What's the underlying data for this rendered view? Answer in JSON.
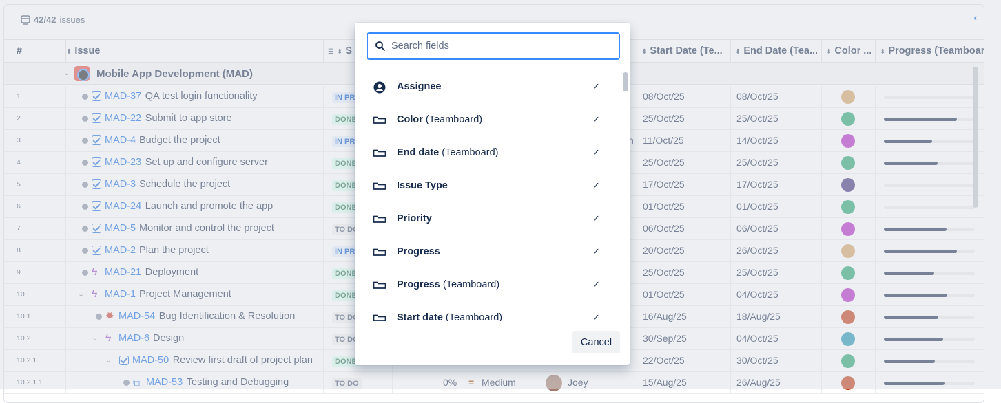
{
  "toolbar": {
    "count_bold": "42/42",
    "count_label": "issues",
    "collapse_icon": "chevron-left-icon"
  },
  "columns": [
    {
      "label": "#"
    },
    {
      "label": "Issue"
    },
    {
      "label": "S"
    },
    {
      "label": "Start Date (Te..."
    },
    {
      "label": "End Date (Tea..."
    },
    {
      "label": "Color ..."
    },
    {
      "label": "Progress (Teamboar"
    }
  ],
  "group": {
    "title": "Mobile App Development  (MAD)"
  },
  "rows": [
    {
      "num": "1",
      "type": "task",
      "key": "MAD-37",
      "summary": "QA test login functionality",
      "status": "IN PRO",
      "status_kind": "inprog",
      "start": "08/Oct/25",
      "end": "08/Oct/25",
      "color": "#d4a060",
      "progress": 0
    },
    {
      "num": "2",
      "type": "task",
      "key": "MAD-22",
      "summary": "Submit to app store",
      "status": "DONE",
      "status_kind": "done",
      "start": "25/Oct/25",
      "end": "25/Oct/25",
      "color": "#1fa36d",
      "progress": 0.8
    },
    {
      "num": "3",
      "type": "task",
      "key": "MAD-4",
      "summary": "Budget the project",
      "status": "IN PRO",
      "status_kind": "inprog",
      "start": "11/Oct/25",
      "end": "14/Oct/25",
      "color": "#b01fc4",
      "progress": 0.53
    },
    {
      "num": "4",
      "type": "task",
      "key": "MAD-23",
      "summary": "Set up and configure server",
      "status": "DONE",
      "status_kind": "done",
      "start": "25/Oct/25",
      "end": "25/Oct/25",
      "color": "#1fa36d",
      "progress": 0.59
    },
    {
      "num": "5",
      "type": "task",
      "key": "MAD-3",
      "summary": "Schedule the project",
      "status": "DONE",
      "status_kind": "done",
      "start": "17/Oct/25",
      "end": "17/Oct/25",
      "color": "#3a2a7a",
      "progress": 0
    },
    {
      "num": "6",
      "type": "task",
      "key": "MAD-24",
      "summary": "Launch and promote the app",
      "status": "DONE",
      "status_kind": "done",
      "start": "01/Oct/25",
      "end": "01/Oct/25",
      "color": "#1fa36d",
      "progress": 0
    },
    {
      "num": "7",
      "type": "task",
      "key": "MAD-5",
      "summary": "Monitor and control the project",
      "status": "TO DO",
      "status_kind": "todo",
      "start": "06/Oct/25",
      "end": "06/Oct/25",
      "color": "#b01fc4",
      "progress": 0.69
    },
    {
      "num": "8",
      "type": "task",
      "key": "MAD-2",
      "summary": "Plan the project",
      "status": "IN PRO",
      "status_kind": "inprog",
      "start": "20/Oct/25",
      "end": "26/Oct/25",
      "color": "#d4a060",
      "progress": 0.8
    },
    {
      "num": "9",
      "type": "epic",
      "key": "MAD-21",
      "summary": "Deployment",
      "status": "DONE",
      "status_kind": "done",
      "start": "25/Oct/25",
      "end": "25/Oct/25",
      "color": "#1fa36d",
      "progress": 0.55
    },
    {
      "num": "10",
      "type": "epic",
      "key": "MAD-1",
      "summary": "Project Management",
      "status": "DONE",
      "status_kind": "done",
      "start": "01/Oct/25",
      "end": "04/Oct/25",
      "color": "#b01fc4",
      "progress": 0.7
    },
    {
      "num": "10.1",
      "type": "bug",
      "key": "MAD-54",
      "summary": "Bug Identification & Resolution",
      "status": "TO DO",
      "status_kind": "todo",
      "start": "16/Aug/25",
      "end": "18/Aug/25",
      "color": "#c0360f",
      "progress": 0.6
    },
    {
      "num": "10.2",
      "type": "epic",
      "key": "MAD-6",
      "summary": "Design",
      "status": "TO DO",
      "status_kind": "todo",
      "start": "30/Sep/25",
      "end": "04/Oct/25",
      "color": "#1a8fb0",
      "progress": 0.65
    },
    {
      "num": "10.2.1",
      "type": "task",
      "key": "MAD-50",
      "summary": "Review first draft of project plan",
      "status": "DONE",
      "status_kind": "done",
      "start": "22/Oct/25",
      "end": "30/Oct/25",
      "color": "#1fa36d",
      "progress": 0.56
    },
    {
      "num": "10.2.1.1",
      "type": "subtask",
      "key": "MAD-53",
      "summary": "Testing and Debugging",
      "status": "TO DO",
      "status_kind": "todo",
      "start": "15/Aug/25",
      "end": "26/Aug/25",
      "color": "#c0360f",
      "progress": 0.67
    }
  ],
  "last_row_extra": {
    "percent": "0%",
    "priority": "Medium",
    "assignee": "Joey"
  },
  "row3_fragment": "n",
  "modal": {
    "search": {
      "placeholder": "Search fields",
      "value": ""
    },
    "fields": [
      {
        "name": "Assignee",
        "suffix": "",
        "icon": "person-icon",
        "checked": true
      },
      {
        "name": "Color",
        "suffix": "(Teamboard)",
        "icon": "field-icon",
        "checked": true
      },
      {
        "name": "End date",
        "suffix": "(Teamboard)",
        "icon": "field-icon",
        "checked": true
      },
      {
        "name": "Issue Type",
        "suffix": "",
        "icon": "field-icon",
        "checked": true
      },
      {
        "name": "Priority",
        "suffix": "",
        "icon": "field-icon",
        "checked": true
      },
      {
        "name": "Progress",
        "suffix": "",
        "icon": "field-icon",
        "checked": true
      },
      {
        "name": "Progress",
        "suffix": "(Teamboard)",
        "icon": "field-icon",
        "checked": true
      },
      {
        "name": "Start date",
        "suffix": "(Teamboard)",
        "icon": "field-icon",
        "checked": true
      }
    ],
    "cancel_label": "Cancel"
  }
}
